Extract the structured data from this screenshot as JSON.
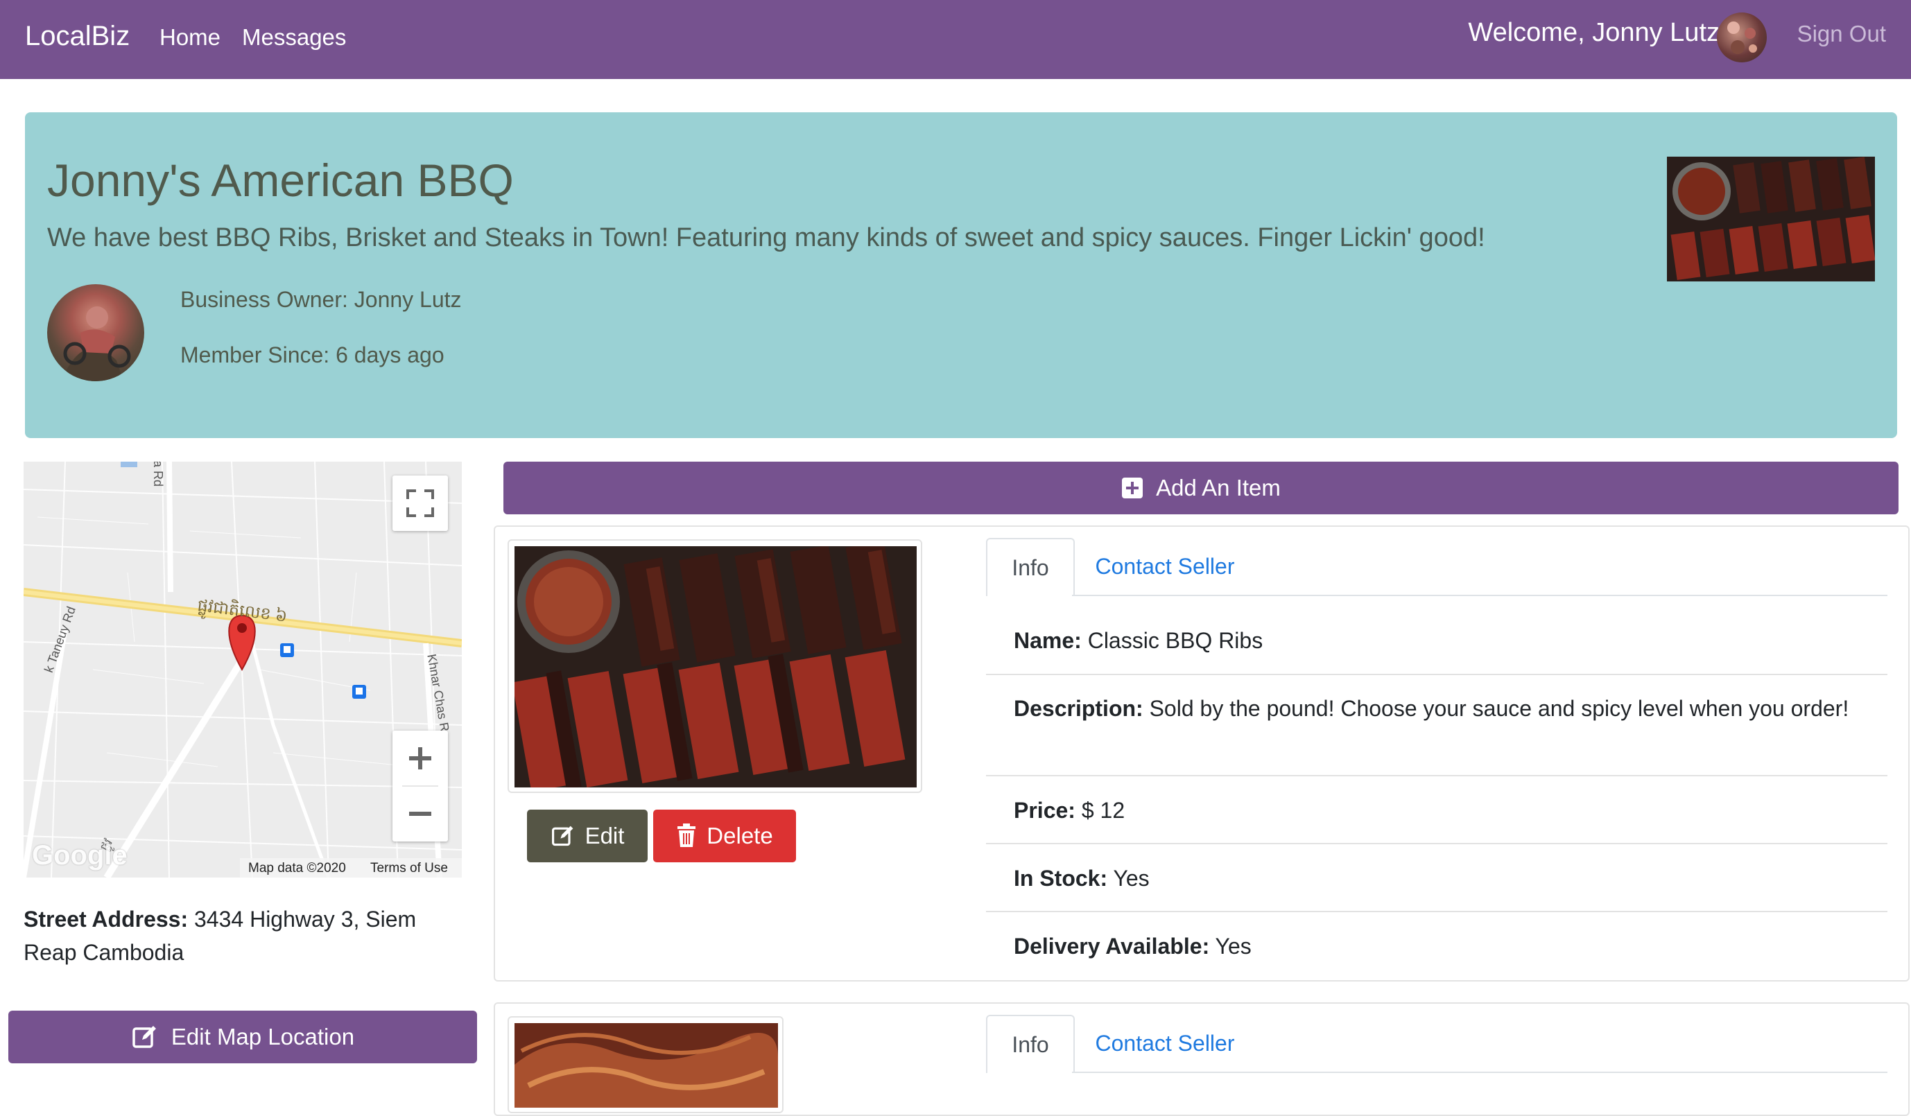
{
  "navbar": {
    "brand": "LocalBiz",
    "links": [
      "Home",
      "Messages"
    ],
    "welcome": "Welcome, Jonny Lutz",
    "sign_out": "Sign Out"
  },
  "business": {
    "name": "Jonny's American BBQ",
    "description": "We have best BBQ Ribs, Brisket and Steaks in Town! Featuring many kinds of sweet and spicy sauces. Finger Lickin' good!",
    "owner": "Business Owner: Jonny Lutz",
    "member_since": "Member Since: 6 days ago"
  },
  "map": {
    "road_labels": [
      "ra Rd",
      "ផ្លូវជាតិលេខ ៦",
      "k Taneuy Rd",
      "Khnar Chas R",
      "ផ្លូវ"
    ],
    "footer_google": "Google",
    "footer_data": "Map data ©2020",
    "footer_terms": "Terms of Use",
    "icons": [
      "fullscreen-icon",
      "zoom-in-icon",
      "zoom-out-icon",
      "location-pin-icon",
      "bus-stop-icon"
    ]
  },
  "address": {
    "label": "Street Address:",
    "value": "3434 Highway 3, Siem Reap Cambodia"
  },
  "buttons": {
    "edit_map": "Edit Map Location",
    "add_item": "Add An Item",
    "edit": "Edit",
    "delete": "Delete"
  },
  "items": [
    {
      "tabs": [
        "Info",
        "Contact Seller"
      ],
      "name_label": "Name:",
      "name": "Classic BBQ Ribs",
      "desc_label": "Description:",
      "description": "Sold by the pound! Choose your sauce and spicy level when you order!",
      "price_label": "Price:",
      "price": "$ 12",
      "stock_label": "In Stock:",
      "stock": "Yes",
      "delivery_label": "Delivery Available:",
      "delivery": "Yes"
    },
    {
      "tabs": [
        "Info",
        "Contact Seller"
      ]
    }
  ],
  "colors": {
    "navbar": "#76528f",
    "jumbotron": "#9ad1d4",
    "edit_button": "#555545",
    "delete_button": "#dc3232",
    "link": "#1f7ae0"
  }
}
